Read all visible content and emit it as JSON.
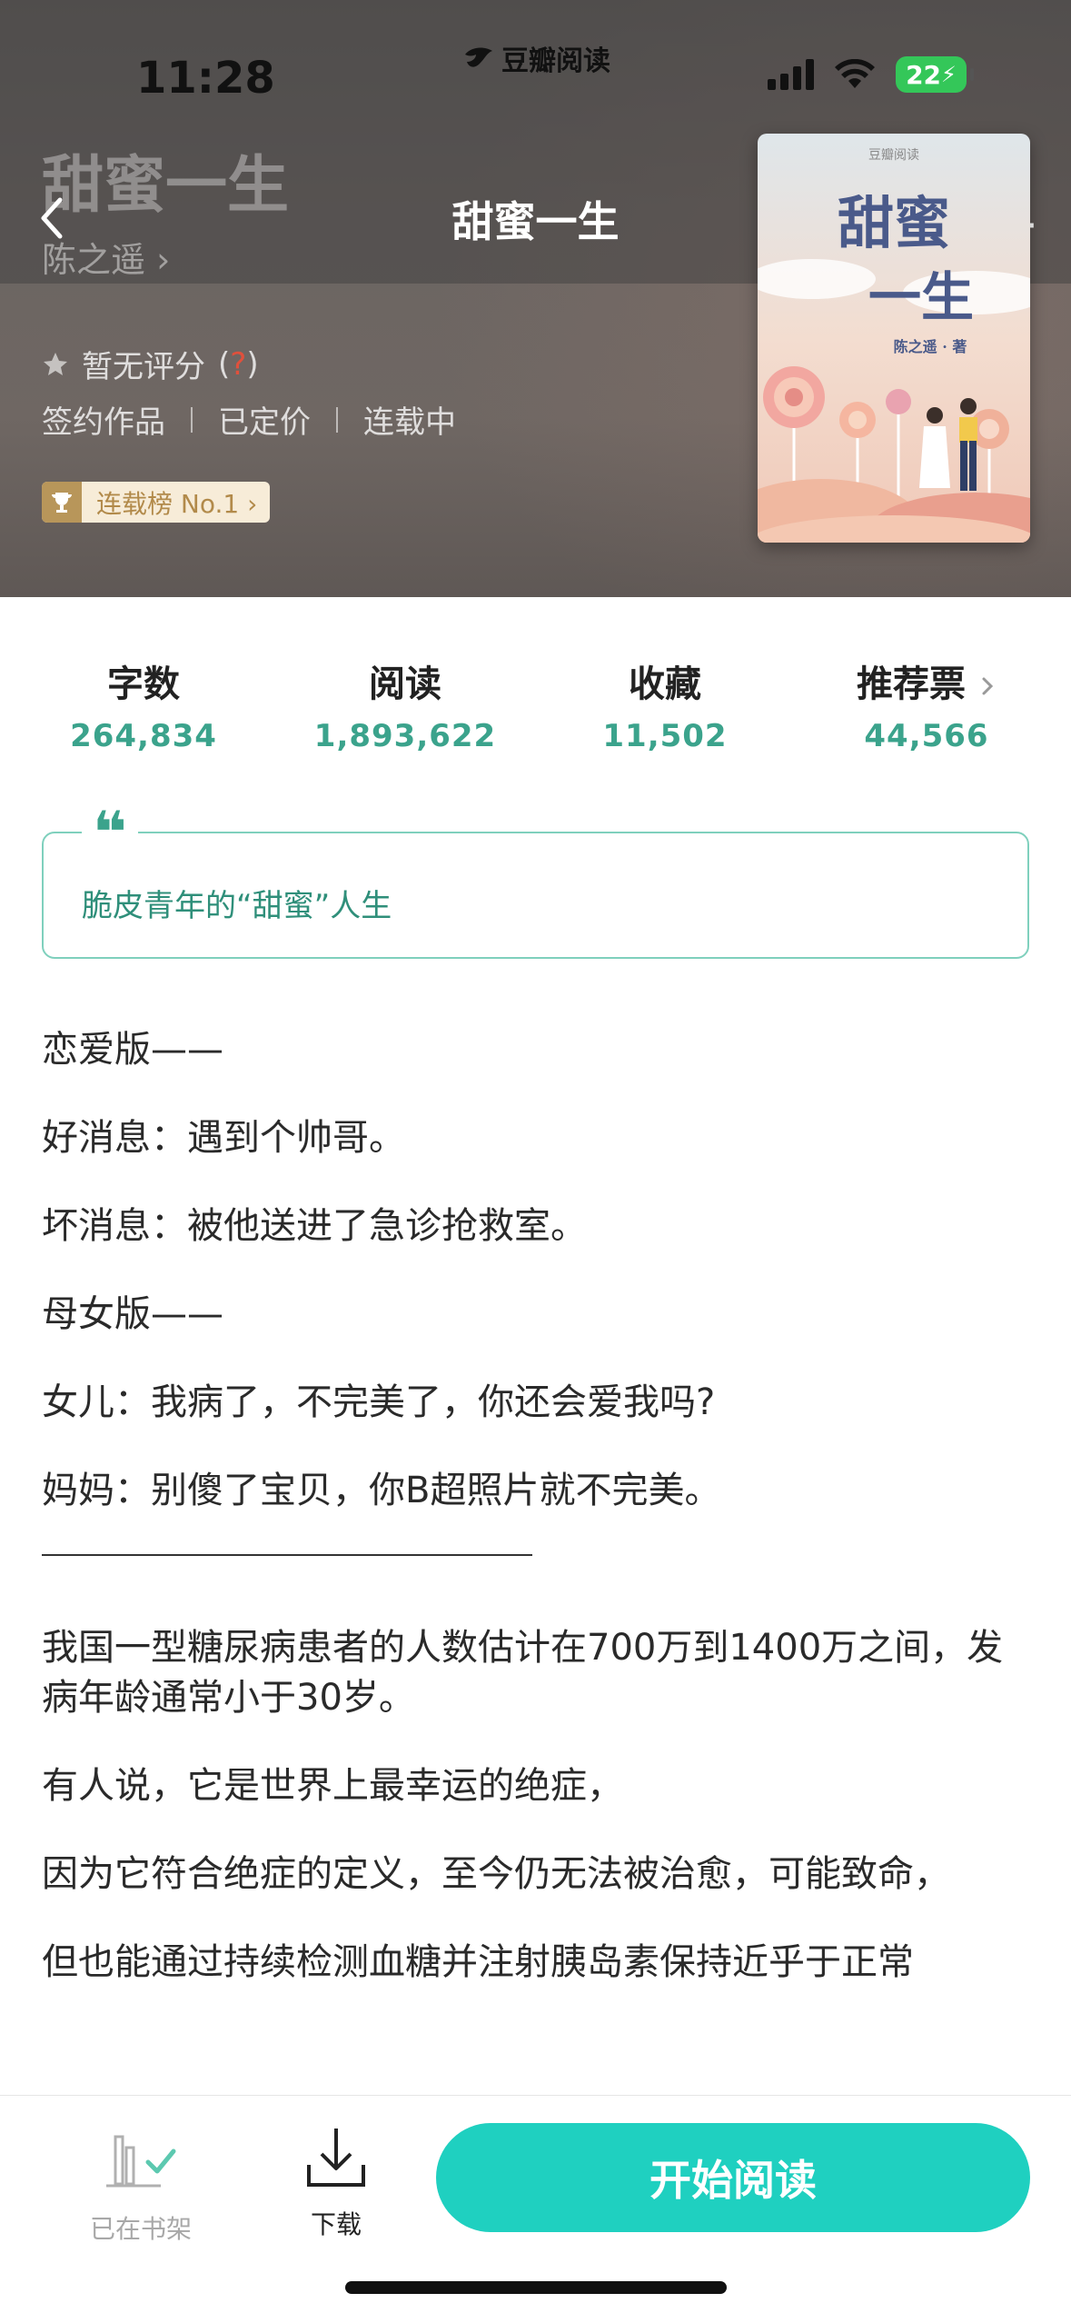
{
  "status_bar": {
    "time": "11:28",
    "app_name": "豆瓣阅读",
    "battery": "22"
  },
  "header": {
    "title": "甜蜜一生",
    "nav_title": "甜蜜一生",
    "author": "陈之遥 ›",
    "rating_text": "暂无评分",
    "rating_help_open": "(",
    "rating_help_q": "?",
    "rating_help_close": ")",
    "tags": [
      "签约作品",
      "已定价",
      "连载中"
    ],
    "rank_label": "连载榜 No.1 ›",
    "more_label": "···"
  },
  "cover": {
    "publisher": "豆瓣阅读",
    "title_line1": "甜蜜",
    "title_line2": "一生",
    "author_line": "陈之遥 · 著"
  },
  "stats": [
    {
      "label": "字数",
      "value": "264,834"
    },
    {
      "label": "阅读",
      "value": "1,893,622"
    },
    {
      "label": "收藏",
      "value": "11,502"
    },
    {
      "label": "推荐票",
      "value": "44,566"
    }
  ],
  "quote": {
    "mark": "❝",
    "text": "脆皮青年的“甜蜜”人生"
  },
  "description": {
    "lines_top": [
      "恋爱版——",
      "好消息：遇到个帅哥。",
      "坏消息：被他送进了急诊抢救室。",
      "母女版——",
      "女儿：我病了，不完美了，你还会爱我吗?",
      "妈妈：别傻了宝贝，你B超照片就不完美。"
    ],
    "lines_bottom": [
      "我国一型糖尿病患者的人数估计在700万到1400万之间，发病年龄通常小于30岁。",
      "有人说，它是世界上最幸运的绝症，",
      "因为它符合绝症的定义，至今仍无法被治愈，可能致命，",
      "但也能通过持续检测血糖并注射胰岛素保持近乎于正常"
    ]
  },
  "bottom_bar": {
    "shelf_label": "已在书架",
    "download_label": "下载",
    "start_label": "开始阅读"
  },
  "colors": {
    "accent": "#3ba38c",
    "button": "#1fd0c0",
    "hero_bg": "#6b6562"
  }
}
